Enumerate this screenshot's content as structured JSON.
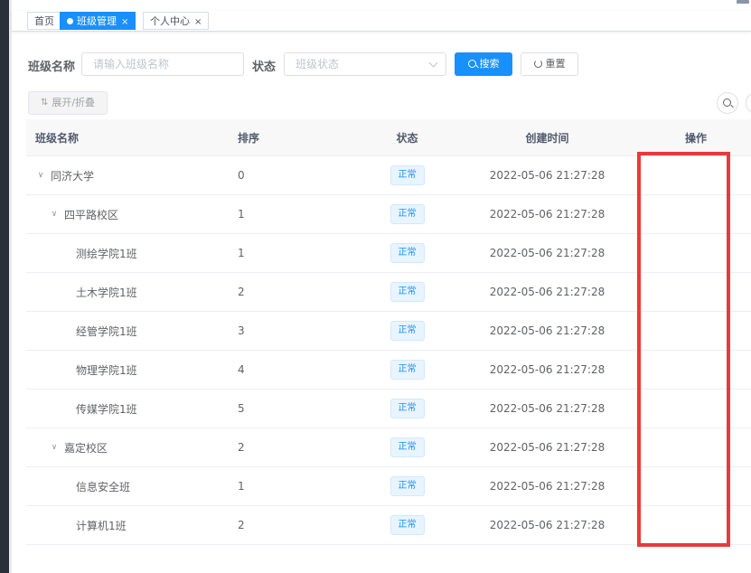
{
  "tags": [
    {
      "label": "首页",
      "active": false,
      "closable": false
    },
    {
      "label": "班级管理",
      "active": true,
      "closable": true
    },
    {
      "label": "个人中心",
      "active": false,
      "closable": true
    }
  ],
  "close_glyph": "×",
  "search": {
    "name_label": "班级名称",
    "name_placeholder": "请输入班级名称",
    "status_label": "状态",
    "status_placeholder": "班级状态",
    "search_button": "搜索",
    "reset_button": "重置"
  },
  "toolbar": {
    "expand_button": "展开/折叠"
  },
  "table": {
    "columns": [
      "班级名称",
      "排序",
      "状态",
      "创建时间",
      "操作"
    ],
    "rows": [
      {
        "name": "同济大学",
        "level": 0,
        "expandable": true,
        "sort": "0",
        "status": "正常",
        "time": "2022-05-06 21:27:28"
      },
      {
        "name": "四平路校区",
        "level": 1,
        "expandable": true,
        "sort": "1",
        "status": "正常",
        "time": "2022-05-06 21:27:28"
      },
      {
        "name": "测绘学院1班",
        "level": 2,
        "expandable": false,
        "sort": "1",
        "status": "正常",
        "time": "2022-05-06 21:27:28"
      },
      {
        "name": "土木学院1班",
        "level": 2,
        "expandable": false,
        "sort": "2",
        "status": "正常",
        "time": "2022-05-06 21:27:28"
      },
      {
        "name": "经管学院1班",
        "level": 2,
        "expandable": false,
        "sort": "3",
        "status": "正常",
        "time": "2022-05-06 21:27:28"
      },
      {
        "name": "物理学院1班",
        "level": 2,
        "expandable": false,
        "sort": "4",
        "status": "正常",
        "time": "2022-05-06 21:27:28"
      },
      {
        "name": "传媒学院1班",
        "level": 2,
        "expandable": false,
        "sort": "5",
        "status": "正常",
        "time": "2022-05-06 21:27:28"
      },
      {
        "name": "嘉定校区",
        "level": 1,
        "expandable": true,
        "sort": "2",
        "status": "正常",
        "time": "2022-05-06 21:27:28"
      },
      {
        "name": "信息安全班",
        "level": 2,
        "expandable": false,
        "sort": "1",
        "status": "正常",
        "time": "2022-05-06 21:27:28"
      },
      {
        "name": "计算机1班",
        "level": 2,
        "expandable": false,
        "sort": "2",
        "status": "正常",
        "time": "2022-05-06 21:27:28"
      }
    ]
  },
  "icons": {
    "expand": "chevron-down-icon",
    "search": "search-icon",
    "reset": "refresh-icon",
    "sort": "sort-icon"
  },
  "colors": {
    "primary": "#1890ff",
    "highlight": "#e83a3a",
    "sidebar": "#2b2f3a"
  }
}
